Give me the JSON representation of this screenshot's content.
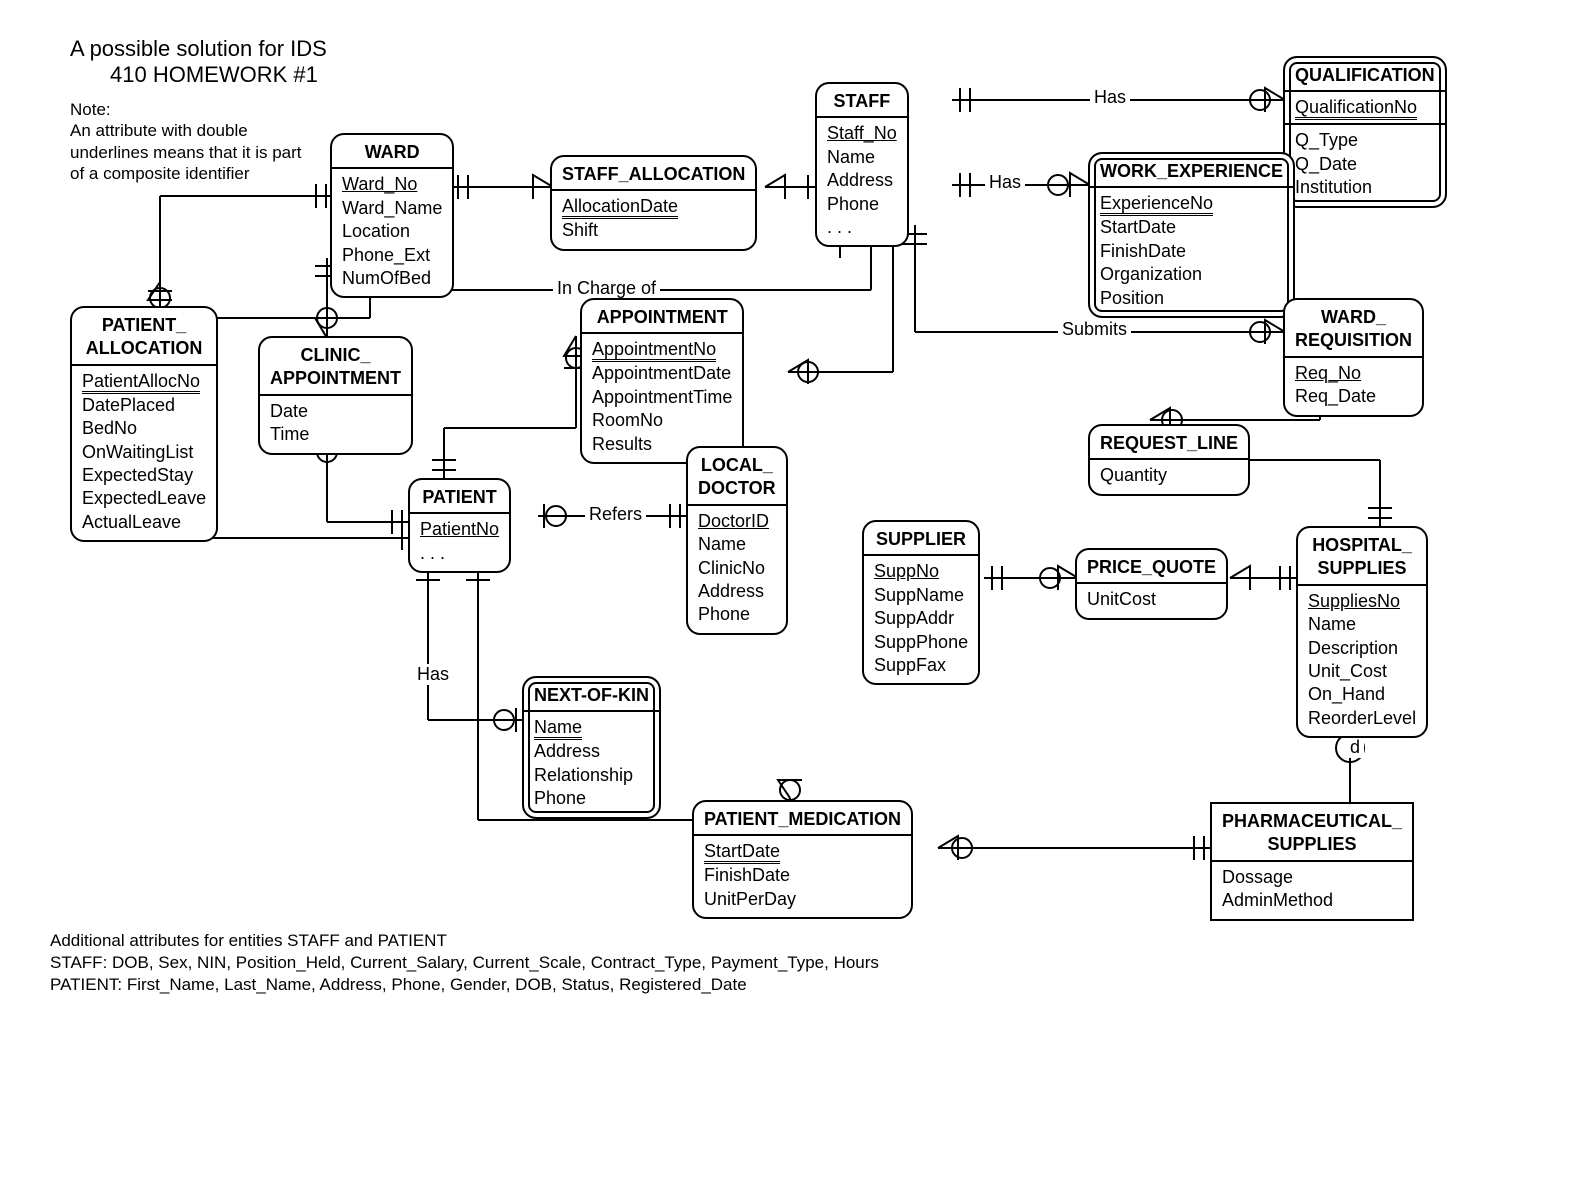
{
  "title": {
    "line1": "A possible solution for IDS",
    "line2": "410 HOMEWORK #1"
  },
  "note": "Note:\nAn attribute with double\nunderlines  means that it is part\nof a composite identifier",
  "footer": {
    "heading": "Additional attributes for entities STAFF and PATIENT",
    "staff": "STAFF: DOB, Sex, NIN, Position_Held, Current_Salary, Current_Scale, Contract_Type, Payment_Type, Hours",
    "patient": "PATIENT: First_Name, Last_Name, Address, Phone, Gender, DOB, Status, Registered_Date"
  },
  "entities": {
    "ward": {
      "name": "WARD",
      "pk": "Ward_No",
      "attrs": [
        "Ward_Name",
        "Location",
        "Phone_Ext",
        "NumOfBed"
      ]
    },
    "staff_allocation": {
      "name": "STAFF_ALLOCATION",
      "pk": "AllocationDate",
      "attrs": [
        "Shift"
      ]
    },
    "staff": {
      "name": "STAFF",
      "pk": "Staff_No",
      "attrs": [
        "Name",
        "Address",
        "Phone",
        ". . ."
      ]
    },
    "qualification": {
      "name": "QUALIFICATION",
      "pk": "QualificationNo",
      "attrs": [
        "Q_Type",
        "Q_Date",
        "Institution"
      ]
    },
    "work_experience": {
      "name": "WORK_EXPERIENCE",
      "pk": "ExperienceNo",
      "attrs": [
        "StartDate",
        "FinishDate",
        "Organization",
        "Position"
      ]
    },
    "patient_allocation": {
      "name1": "PATIENT_",
      "name2": "ALLOCATION",
      "pk": "PatientAllocNo",
      "attrs": [
        "DatePlaced",
        "BedNo",
        "OnWaitingList",
        "ExpectedStay",
        "ExpectedLeave",
        "ActualLeave"
      ]
    },
    "clinic_appointment": {
      "name1": "CLINIC_",
      "name2": "APPOINTMENT",
      "attrs": [
        "Date",
        "Time"
      ]
    },
    "appointment": {
      "name": "APPOINTMENT",
      "pk": "AppointmentNo",
      "attrs": [
        "AppointmentDate",
        "AppointmentTime",
        "RoomNo",
        "Results"
      ]
    },
    "ward_requisition": {
      "name1": "WARD_",
      "name2": "REQUISITION",
      "pk": "Req_No",
      "attrs": [
        "Req_Date"
      ]
    },
    "request_line": {
      "name": "REQUEST_LINE",
      "attrs": [
        "Quantity"
      ]
    },
    "patient": {
      "name": "PATIENT",
      "pk": "PatientNo",
      "attrs": [
        ". . ."
      ]
    },
    "local_doctor": {
      "name1": "LOCAL_",
      "name2": "DOCTOR",
      "pk": "DoctorID",
      "attrs": [
        "Name",
        "ClinicNo",
        "Address",
        "Phone"
      ]
    },
    "supplier": {
      "name": "SUPPLIER",
      "pk": "SuppNo",
      "attrs": [
        "SuppName",
        "SuppAddr",
        "SuppPhone",
        "SuppFax"
      ]
    },
    "price_quote": {
      "name": "PRICE_QUOTE",
      "attrs": [
        "UnitCost"
      ]
    },
    "hospital_supplies": {
      "name1": "HOSPITAL_",
      "name2": "SUPPLIES",
      "pk": "SuppliesNo",
      "attrs": [
        "Name",
        "Description",
        "Unit_Cost",
        "On_Hand",
        "ReorderLevel"
      ]
    },
    "next_of_kin": {
      "name": "NEXT-OF-KIN",
      "pk": "Name",
      "attrs": [
        "Address",
        "Relationship",
        "Phone"
      ]
    },
    "patient_medication": {
      "name": "PATIENT_MEDICATION",
      "pk": "StartDate",
      "attrs": [
        "FinishDate",
        "UnitPerDay"
      ]
    },
    "pharmaceutical_supplies": {
      "name1": "PHARMACEUTICAL_",
      "name2": "SUPPLIES",
      "attrs": [
        "Dossage",
        "AdminMethod"
      ]
    }
  },
  "labels": {
    "has1": "Has",
    "has2": "Has",
    "has3": "Has",
    "in_charge_of": "In Charge of",
    "submits": "Submits",
    "refers": "Refers",
    "d": "d"
  }
}
